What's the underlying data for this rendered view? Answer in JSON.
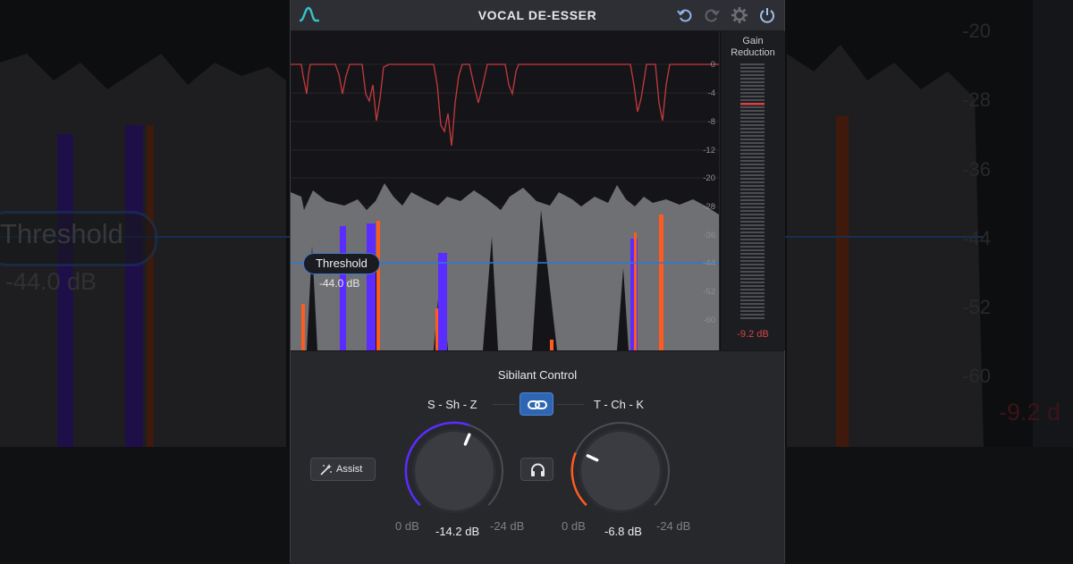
{
  "background": {
    "threshold_label": "Threshold",
    "threshold_value": "-44.0 dB",
    "scale": [
      "-20",
      "-28",
      "-36",
      "-44",
      "-52",
      "-60"
    ],
    "gain_value": "-9.2 d"
  },
  "plugin": {
    "title": "VOCAL DE-ESSER",
    "toolbar": [
      "undo-icon",
      "redo-icon",
      "gear-icon",
      "power-icon"
    ],
    "display": {
      "threshold_label": "Threshold",
      "threshold_value": "-44.0 dB",
      "scale": [
        "0",
        "-4",
        "-8",
        "-12",
        "-20",
        "-28",
        "-36",
        "-44",
        "-52",
        "-60"
      ]
    },
    "meter": {
      "title_line1": "Gain",
      "title_line2": "Reduction",
      "value": "-9.2 dB",
      "level_db": -9.2
    },
    "controls": {
      "section_title": "Sibilant Control",
      "left_band": "S - Sh - Z",
      "right_band": "T - Ch - K",
      "assist_label": "Assist",
      "knob_left": {
        "min": "0 dB",
        "max": "-24 dB",
        "value": "-14.2 dB"
      },
      "knob_right": {
        "min": "0 dB",
        "max": "-24 dB",
        "value": "-6.8 dB"
      }
    },
    "colors": {
      "accent_blue": "#2f66b3",
      "s_band": "#5a2cff",
      "t_band": "#ff5a1f",
      "gr_curve": "#c43a3e"
    }
  }
}
